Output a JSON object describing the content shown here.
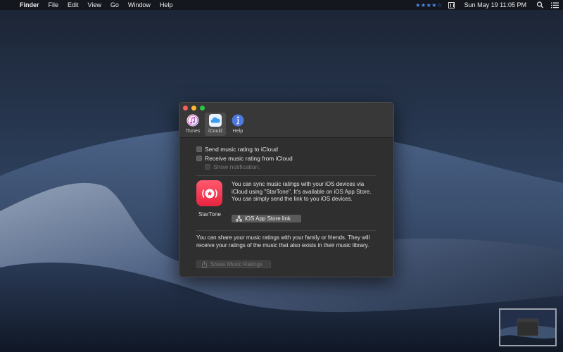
{
  "menubar": {
    "apple_glyph": "",
    "items": [
      "Finder",
      "File",
      "Edit",
      "View",
      "Go",
      "Window",
      "Help"
    ],
    "rating_stars": "★★★★☆",
    "clock": "Sun May 19  11:05 PM"
  },
  "window": {
    "tabs": [
      {
        "label": "iTunes",
        "icon": "itunes-icon"
      },
      {
        "label": "iCould",
        "icon": "icloud-icon"
      },
      {
        "label": "Help",
        "icon": "info-icon"
      }
    ],
    "options": {
      "send": "Send music rating to iCloud",
      "receive": "Receive music rating from iCloud",
      "notify": "Show notification."
    },
    "app": {
      "name": "StarTone",
      "description": "You can sync music ratings with your iOS devices via iCloud using \"StarTone\".  It's available on iOS App Store. You can simply send the link to you iOS devices.",
      "button": "iOS App Store link"
    },
    "share": {
      "description": "You can share your music ratings with your family or friends. They will receive your ratings of the music that also exists in their music library.",
      "button": "Share Music Ratings"
    }
  },
  "colors": {
    "accent_star": "#4a8ff0",
    "app_icon": "#f0344c"
  }
}
